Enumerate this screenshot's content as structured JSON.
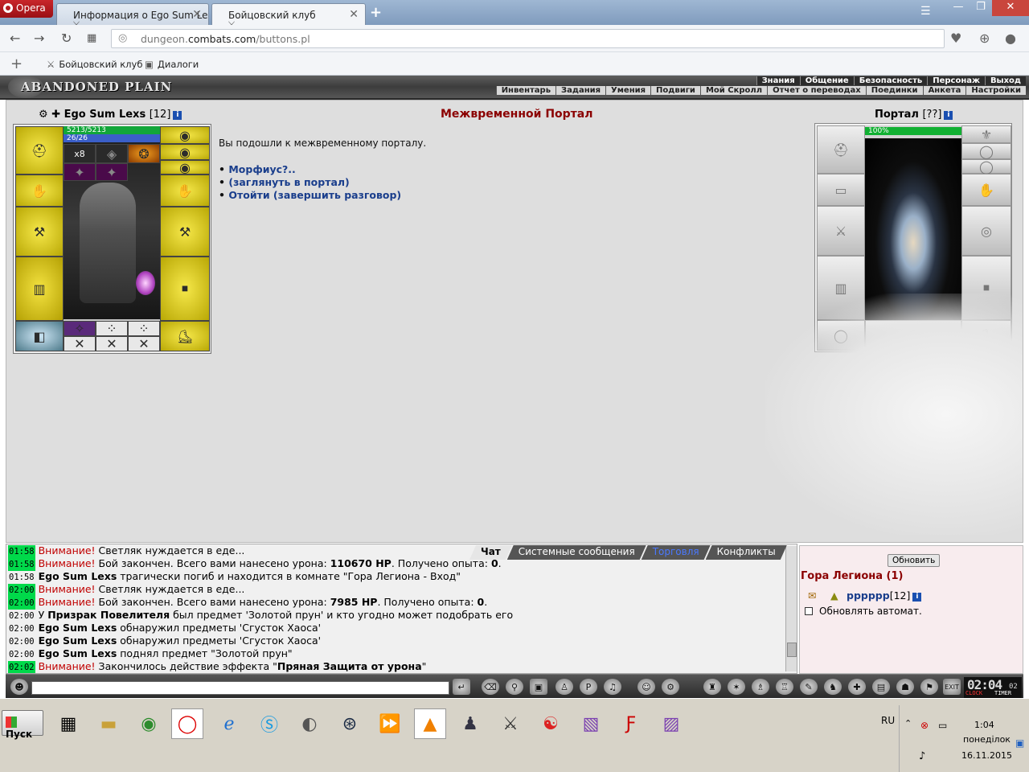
{
  "browser": {
    "menu_label": "Opera",
    "tabs": [
      {
        "label": "Информация о Ego Sum Lexs"
      },
      {
        "label": "Бойцовский клуб"
      }
    ],
    "url_host": "dungeon.",
    "url_domain": "combats.com",
    "url_path": "/buttons.pl",
    "bookmarks": [
      {
        "label": "Бойцовский клуб"
      },
      {
        "label": "Диалоги"
      }
    ]
  },
  "game_nav": {
    "logo": "ABANDONED PLAIN",
    "top_links": [
      "Знания",
      "Общение",
      "Безопасность",
      "Персонаж",
      "Выход"
    ],
    "bottom_links": [
      "Инвентарь",
      "Задания",
      "Умения",
      "Подвиги",
      "Мой Скролл",
      "Отчет о переводах",
      "Поединки",
      "Анкета",
      "Настройки"
    ]
  },
  "character": {
    "name": "Ego Sum Lexs",
    "level": "[12]",
    "hp": "5213/5213",
    "mana": "26/26",
    "item_count": "x8"
  },
  "dialog": {
    "title": "Межвременной Портал",
    "text": "Вы подошли к межвременному порталу.",
    "options": [
      {
        "bullet": "•",
        "label": "Морфиус?.."
      },
      {
        "bullet": "•",
        "label": "(заглянуть в портал)"
      },
      {
        "bullet": "•",
        "label": "Отойти (завершить разговор)"
      }
    ]
  },
  "portal": {
    "name": "Портал",
    "level": "[??]",
    "hp_percent": "100%"
  },
  "chat": {
    "tabs": [
      {
        "label": "Чат",
        "active": true
      },
      {
        "label": "Системные сообщения"
      },
      {
        "label": "Торговля"
      },
      {
        "label": "Конфликты"
      }
    ],
    "lines": [
      {
        "time": "01:58",
        "hl": true,
        "prefix": "Внимание!",
        "bold": "",
        "text": " Светляк нуждается в еде..."
      },
      {
        "time": "01:58",
        "hl": true,
        "prefix": "Внимание!",
        "text1": " Бой закончен. Всего вами нанесено урона: ",
        "b1": "110670 HP",
        "text2": ". Получено опыта: ",
        "b2": "0",
        "text3": "."
      },
      {
        "time": "01:58",
        "hl": false,
        "bold": "Ego Sum Lexs",
        "text": " трагически погиб и находится в комнате \"Гора Легиона - Вход\""
      },
      {
        "time": "02:00",
        "hl": true,
        "prefix": "Внимание!",
        "text": " Светляк нуждается в еде..."
      },
      {
        "time": "02:00",
        "hl": true,
        "prefix": "Внимание!",
        "text1": " Бой закончен. Всего вами нанесено урона: ",
        "b1": "7985 HP",
        "text2": ". Получено опыта: ",
        "b2": "0",
        "text3": "."
      },
      {
        "time": "02:00",
        "hl": false,
        "pre": "У ",
        "bold": "Призрак Повелителя",
        "text": " был предмет 'Золотой прун' и кто угодно может подобрать его"
      },
      {
        "time": "02:00",
        "hl": false,
        "bold": "Ego Sum Lexs",
        "text": " обнаружил предметы 'Сгусток Хаоса'"
      },
      {
        "time": "02:00",
        "hl": false,
        "bold": "Ego Sum Lexs",
        "text": " обнаружил предметы 'Сгусток Хаоса'"
      },
      {
        "time": "02:00",
        "hl": false,
        "bold": "Ego Sum Lexs",
        "text": " поднял предмет \"Золотой прун\""
      },
      {
        "time": "02:02",
        "hl": true,
        "prefix": "Внимание!",
        "text": " Закончилось действие эффекта \"",
        "b1": "Пряная Защита от урона",
        "text2": "\""
      }
    ]
  },
  "online": {
    "refresh_label": "Обновить",
    "room": "Гора Легиона (1)",
    "player_name": "pppppp",
    "player_level": "[12]",
    "auto_refresh_label": "Обновлять автомат."
  },
  "clock": {
    "time": "02:04",
    "seconds": "02",
    "label1": "CLOCK",
    "label2": "TIMER"
  },
  "taskbar": {
    "start_label": "Пуск",
    "lang": "RU",
    "time": "1:04",
    "day": "понеділок",
    "date": "16.11.2015"
  }
}
